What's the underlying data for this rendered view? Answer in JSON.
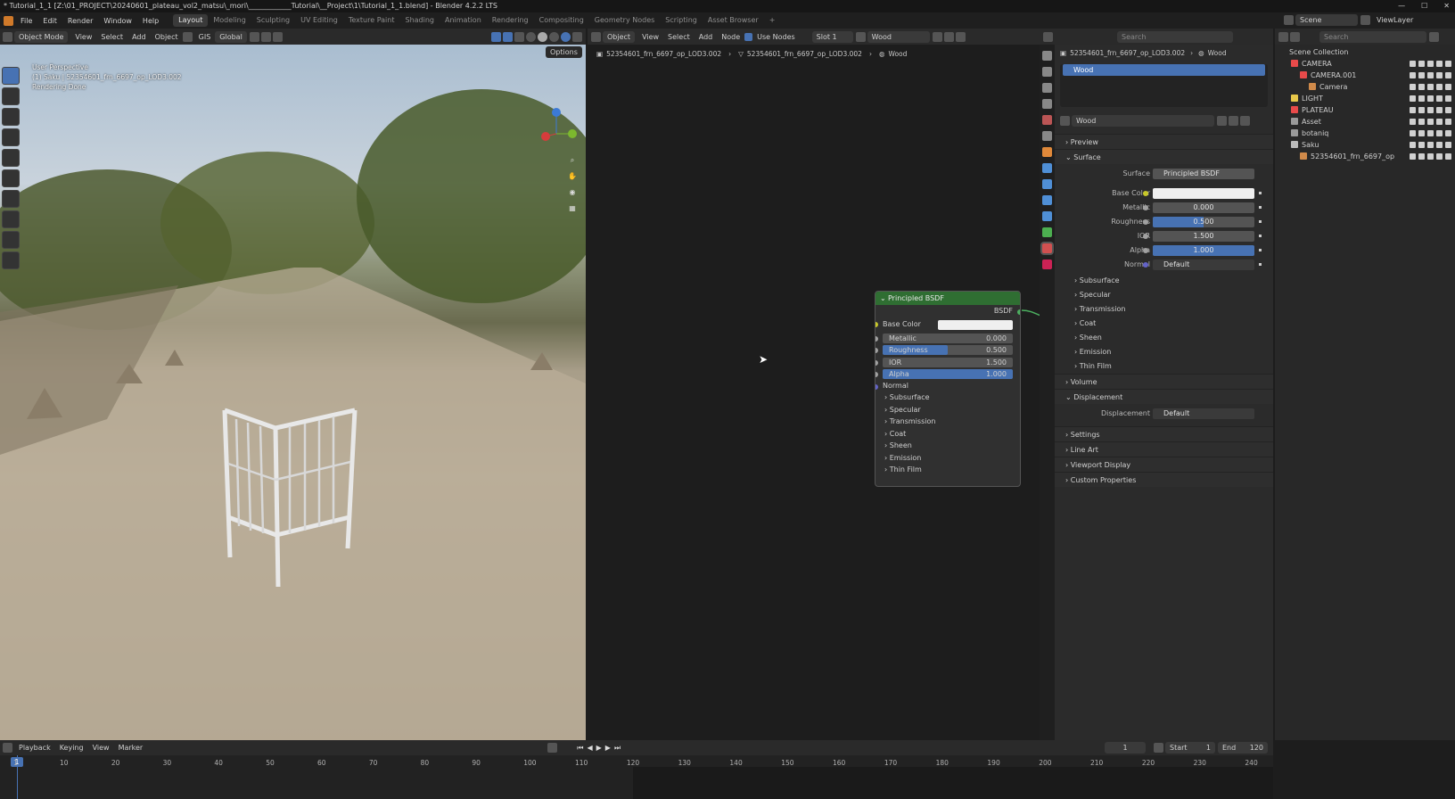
{
  "window": {
    "title": "* Tutorial_1_1 [Z:\\01_PROJECT\\20240601_plateau_vol2_matsu\\_mori\\____________Tutorial\\__Project\\1\\Tutorial_1_1.blend] - Blender 4.2.2 LTS"
  },
  "menu": {
    "items": [
      "File",
      "Edit",
      "Render",
      "Window",
      "Help"
    ]
  },
  "workspaces": [
    "Layout",
    "Modeling",
    "Sculpting",
    "UV Editing",
    "Texture Paint",
    "Shading",
    "Animation",
    "Rendering",
    "Compositing",
    "Geometry Nodes",
    "Scripting",
    "Asset Browser",
    "+"
  ],
  "topright": {
    "scene": "Scene",
    "view_layer": "ViewLayer"
  },
  "viewport": {
    "mode": "Object Mode",
    "menu": [
      "View",
      "Select",
      "Add",
      "Object"
    ],
    "gis": "GIS",
    "orientation": "Global",
    "options": "Options",
    "overlay_lines": [
      "User Perspective",
      "(1) Saku | 52354601_frn_6697_op_LOD3.002",
      "Rendering Done"
    ],
    "gizmo": {
      "x": "X",
      "y": "Y",
      "z": "Z"
    }
  },
  "node_editor": {
    "editor": "Object",
    "menu": [
      "View",
      "Select",
      "Add",
      "Node"
    ],
    "use_nodes": "Use Nodes",
    "slot": "Slot 1",
    "material": "Wood",
    "breadcrumb": [
      "52354601_frn_6697_op_LOD3.002",
      "52354601_frn_6697_op_LOD3.002",
      "Wood"
    ]
  },
  "node": {
    "title": "Principled BSDF",
    "output": "BSDF",
    "base_color_label": "Base Color",
    "fields": [
      {
        "label": "Metallic",
        "value": "0.000",
        "fraction": 0
      },
      {
        "label": "Roughness",
        "value": "0.500",
        "fraction": 0.5
      },
      {
        "label": "IOR",
        "value": "1.500",
        "fraction": 0
      },
      {
        "label": "Alpha",
        "value": "1.000",
        "fraction": 1
      }
    ],
    "normal": "Normal",
    "panels": [
      "Subsurface",
      "Specular",
      "Transmission",
      "Coat",
      "Sheen",
      "Emission",
      "Thin Film"
    ]
  },
  "properties": {
    "search_placeholder": "Search",
    "breadcrumb": [
      "52354601_frn_6697_op_LOD3.002",
      "Wood"
    ],
    "slot_item": "Wood",
    "material_name": "Wood",
    "preview": "Preview",
    "surface_panel": "Surface",
    "surface_label": "Surface",
    "surface_value": "Principled BSDF",
    "rows": [
      {
        "label": "Base Color",
        "value": ""
      },
      {
        "label": "Metallic",
        "value": "0.000",
        "fraction": 0
      },
      {
        "label": "Roughness",
        "value": "0.500",
        "fraction": 0.5
      },
      {
        "label": "IOR",
        "value": "1.500",
        "fraction": 0
      },
      {
        "label": "Alpha",
        "value": "1.000",
        "fraction": 1
      },
      {
        "label": "Normal",
        "value": "Default"
      }
    ],
    "subpanels": [
      "Subsurface",
      "Specular",
      "Transmission",
      "Coat",
      "Sheen",
      "Emission",
      "Thin Film"
    ],
    "volume": "Volume",
    "displacement_panel": "Displacement",
    "displacement_label": "Displacement",
    "displacement_value": "Default",
    "bottom_panels": [
      "Settings",
      "Line Art",
      "Viewport Display",
      "Custom Properties"
    ]
  },
  "outliner": {
    "search_placeholder": "Search",
    "root": "Scene Collection",
    "items": [
      {
        "label": "CAMERA",
        "indent": 1,
        "color": "#e84a4a"
      },
      {
        "label": "CAMERA.001",
        "indent": 2,
        "color": "#e84a4a"
      },
      {
        "label": "Camera",
        "indent": 3,
        "color": "#d08a4a"
      },
      {
        "label": "LIGHT",
        "indent": 1,
        "color": "#e8c84a"
      },
      {
        "label": "PLATEAU",
        "indent": 1,
        "color": "#e84a4a"
      },
      {
        "label": "Asset",
        "indent": 1,
        "color": "#9a9a9a"
      },
      {
        "label": "botaniq",
        "indent": 1,
        "color": "#9a9a9a"
      },
      {
        "label": "Saku",
        "indent": 1,
        "color": "#bbbbbb"
      },
      {
        "label": "52354601_frn_6697_op",
        "indent": 2,
        "color": "#d08a4a"
      }
    ]
  },
  "timeline": {
    "menu": [
      "Playback",
      "Keying",
      "View",
      "Marker"
    ],
    "current": "1",
    "start_label": "Start",
    "start": "1",
    "end_label": "End",
    "end": "120",
    "ticks": [
      "1",
      "10",
      "20",
      "30",
      "40",
      "50",
      "60",
      "70",
      "80",
      "90",
      "100",
      "110",
      "120",
      "130",
      "140",
      "150",
      "160",
      "170",
      "180",
      "190",
      "200",
      "210",
      "220",
      "230",
      "240"
    ]
  },
  "colors": {
    "accent": "#4772b3",
    "node_header": "#2f6e32"
  }
}
